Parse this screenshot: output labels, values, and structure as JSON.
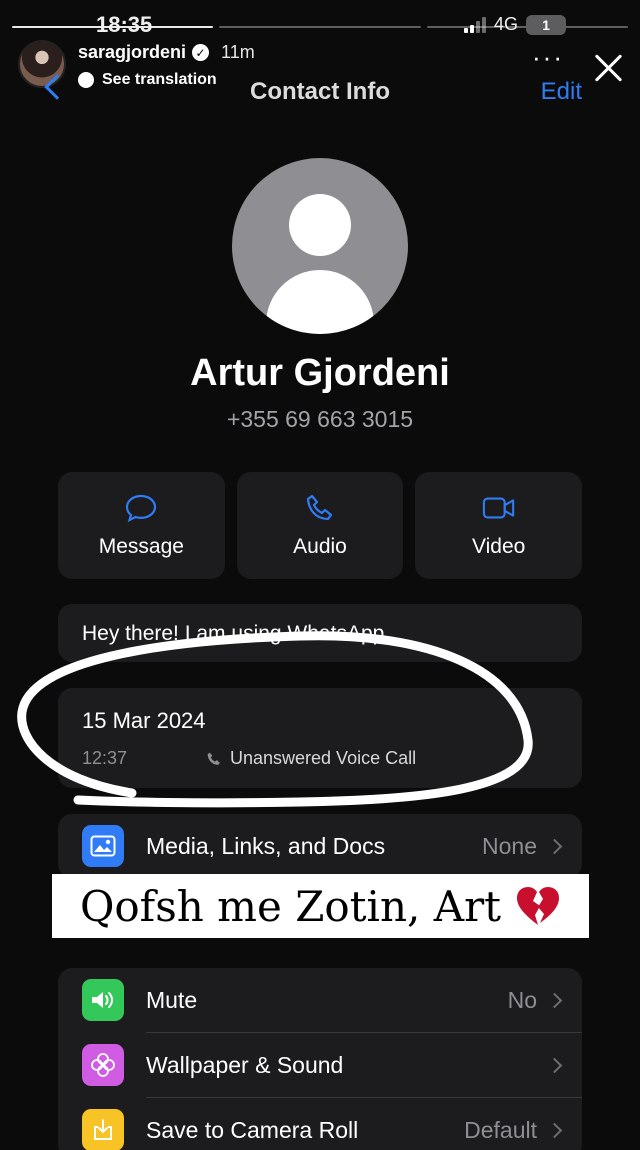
{
  "story": {
    "username": "saragjordeni",
    "posted_ago": "11m",
    "see_translation": "See translation",
    "more_icon": "ellipsis-icon",
    "close_icon": "close-icon",
    "caption": "Qofsh me Zotin, Art",
    "caption_emoji": "broken-heart-icon",
    "progress_segments": 3,
    "progress_active_index": 0
  },
  "status_bar": {
    "time": "18:35",
    "network": "4G",
    "battery": "1"
  },
  "nav": {
    "title": "Contact Info",
    "edit_label": "Edit"
  },
  "contact": {
    "name": "Artur Gjordeni",
    "phone": "+355 69 663 3015",
    "about": "Hey there! I am using WhatsApp."
  },
  "actions": [
    {
      "label": "Message",
      "icon": "chat-bubble-icon"
    },
    {
      "label": "Audio",
      "icon": "phone-icon"
    },
    {
      "label": "Video",
      "icon": "video-camera-icon"
    }
  ],
  "call": {
    "date": "15 Mar 2024",
    "time": "12:37",
    "type": "Unanswered Voice Call"
  },
  "media_row": {
    "label": "Media, Links, and Docs",
    "value": "None"
  },
  "settings": [
    {
      "label": "Mute",
      "value": "No",
      "icon": "speaker-icon",
      "color": "#34c759"
    },
    {
      "label": "Wallpaper & Sound",
      "value": "",
      "icon": "flower-icon",
      "color": "#d05ce3"
    },
    {
      "label": "Save to Camera Roll",
      "value": "Default",
      "icon": "download-icon",
      "color": "#f7c325"
    }
  ],
  "colors": {
    "accent": "#2f7cf6",
    "card": "#1c1c1e",
    "background": "#0b0b0c"
  }
}
